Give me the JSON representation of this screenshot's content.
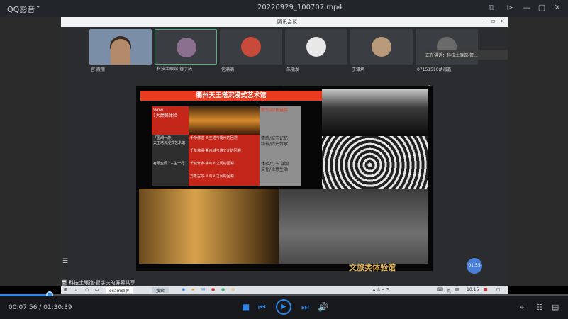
{
  "player": {
    "app_name": "QQ影音",
    "filename": "20220929_100707.mp4",
    "time_label": "00:07:56 / 01:30:39",
    "progress_fraction": 0.088
  },
  "meeting": {
    "window_title": "腾讯会议",
    "participants": [
      {
        "name": "宫 霞丽"
      },
      {
        "name": "科技土眼馆-管字庆"
      },
      {
        "name": "何满满"
      },
      {
        "name": "朱能发"
      },
      {
        "name": "丁骧炳"
      },
      {
        "name": "07151510胡海鑫"
      }
    ],
    "speaking_text": "正在讲话：科技土眼馆-管...",
    "share_label": "科技土眼馆-管宇庆的屏幕共享",
    "share_badge": "01:55"
  },
  "slide": {
    "title": "衢州天王塔沉浸式艺术馆",
    "wow_text": "Wow\n1大巅峰体验",
    "row1_left": "「国潮一游」\n天王塔沉浸式艺术馆",
    "row1_right": "千帝佛迹·天王塔与衢州的回溯",
    "row2_right": "千年佛缘·衢州城与佛文化的回溯",
    "row3_left": "有限空间 “三生一行”",
    "row3_right": "千载轩宇·佛与人之间的回溯",
    "row4_right": "万象古今·人与人之间的回溯",
    "side1": "新引流/长链接",
    "side2": "情感/城市记忆\n精神/历史传承",
    "side3": "体验/打卡 潮流\n文化/禅意生活",
    "caption": "文旅类体验馆"
  },
  "taskbar": {
    "search_label": "ocam录屏",
    "lang": "英",
    "clock": "10:15"
  }
}
